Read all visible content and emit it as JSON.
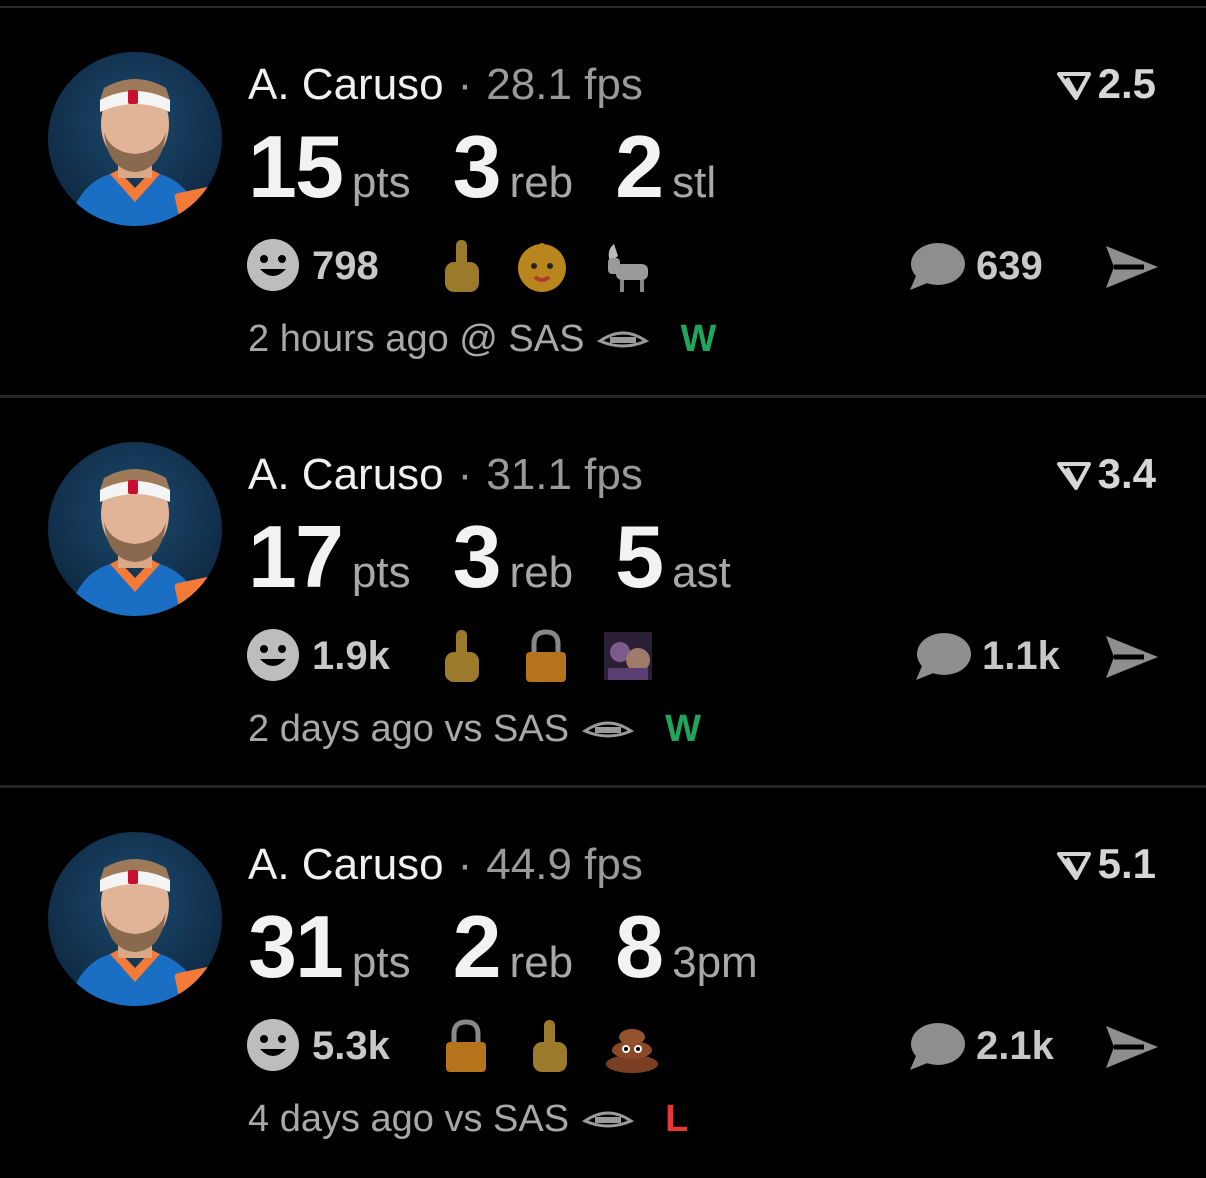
{
  "colors": {
    "win": "#1fa65a",
    "loss": "#e53935",
    "muted": "#9a9a9a"
  },
  "posts": [
    {
      "player": "A. Caruso",
      "fps": "28.1 fps",
      "rating": "2.5",
      "stats": [
        {
          "num": "15",
          "label": "pts"
        },
        {
          "num": "3",
          "label": "reb"
        },
        {
          "num": "2",
          "label": "stl"
        }
      ],
      "reactions_count": "798",
      "emojis": [
        "middle-finger-icon",
        "baby-face-icon",
        "goat-icon"
      ],
      "comments": "639",
      "time": "2 hours ago @ SAS",
      "result": "W"
    },
    {
      "player": "A. Caruso",
      "fps": "31.1 fps",
      "rating": "3.4",
      "stats": [
        {
          "num": "17",
          "label": "pts"
        },
        {
          "num": "3",
          "label": "reb"
        },
        {
          "num": "5",
          "label": "ast"
        }
      ],
      "reactions_count": "1.9k",
      "emojis": [
        "middle-finger-icon",
        "lock-icon",
        "custom-photo-emoji-icon"
      ],
      "comments": "1.1k",
      "time": "2 days ago vs SAS",
      "result": "W"
    },
    {
      "player": "A. Caruso",
      "fps": "44.9 fps",
      "rating": "5.1",
      "stats": [
        {
          "num": "31",
          "label": "pts"
        },
        {
          "num": "2",
          "label": "reb"
        },
        {
          "num": "8",
          "label": "3pm"
        }
      ],
      "reactions_count": "5.3k",
      "emojis": [
        "lock-icon",
        "middle-finger-icon",
        "poop-icon"
      ],
      "comments": "2.1k",
      "time": "4 days ago vs SAS",
      "result": "L"
    }
  ]
}
